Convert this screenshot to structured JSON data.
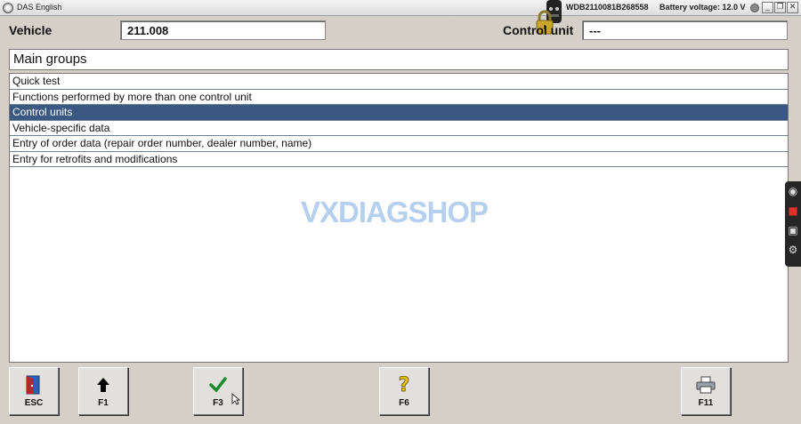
{
  "window": {
    "title": "DAS English",
    "vin": "WDB2110081B268558",
    "battery": "Battery voltage: 12.0 V",
    "buttons": {
      "minimize": "_",
      "restore": "❐",
      "close": "✕"
    }
  },
  "header": {
    "vehicle_label": "Vehicle",
    "vehicle_value": "211.008",
    "control_unit_label": "Control unit",
    "control_unit_value": "---"
  },
  "section_title": "Main groups",
  "menu_items": [
    {
      "label": "Quick test",
      "selected": false
    },
    {
      "label": "Functions performed by more than one control unit",
      "selected": false
    },
    {
      "label": "Control units",
      "selected": true
    },
    {
      "label": "Vehicle-specific data",
      "selected": false
    },
    {
      "label": "Entry of order data (repair order number, dealer number, name)",
      "selected": false
    },
    {
      "label": "Entry for retrofits and modifications",
      "selected": false
    }
  ],
  "watermark": "VXDIAGSHOP",
  "function_keys": [
    {
      "key": "ESC",
      "icon": "exit-door-icon"
    },
    {
      "key": "F1",
      "icon": "arrow-up-icon"
    },
    {
      "key": "F3",
      "icon": "checkmark-icon"
    },
    {
      "key": "F6",
      "icon": "question-help-icon"
    },
    {
      "key": "F11",
      "icon": "printer-icon"
    }
  ],
  "colors": {
    "selection": "#3a5882",
    "row_divider": "#6f8196",
    "background": "#d4d0c8",
    "checkmark": "#1e8a2e",
    "help": "#e8c400"
  }
}
